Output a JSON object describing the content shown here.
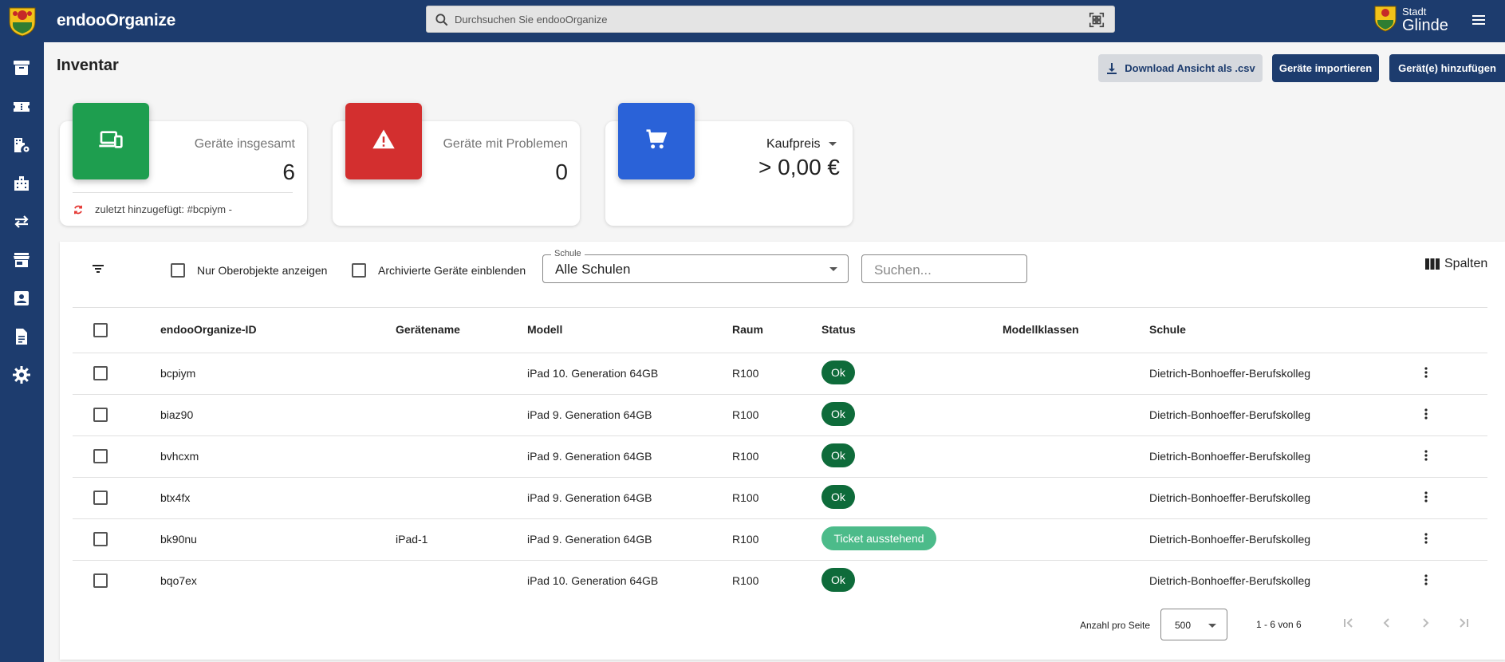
{
  "app": {
    "title": "endooOrganize",
    "search_placeholder": "Durchsuchen Sie endooOrganize",
    "city_small": "Stadt",
    "city_big": "Glinde"
  },
  "sidebar": {
    "items": [
      {
        "icon": "archive-icon"
      },
      {
        "icon": "ticket-icon"
      },
      {
        "icon": "building-settings-icon"
      },
      {
        "icon": "buildings-icon"
      },
      {
        "icon": "swap-arrows-icon"
      },
      {
        "icon": "store-icon"
      },
      {
        "icon": "contact-card-icon"
      },
      {
        "icon": "document-icon"
      },
      {
        "icon": "gear-icon"
      }
    ]
  },
  "header": {
    "title": "Inventar",
    "csv_button": "Download Ansicht als .csv",
    "import_button": "Geräte importieren",
    "add_button": "Gerät(e) hinzufügen"
  },
  "stats": {
    "total": {
      "label": "Geräte insgesamt",
      "value": "6",
      "footer": "zuletzt hinzugefügt: #bcpiym -"
    },
    "problems": {
      "label": "Geräte mit Problemen",
      "value": "0"
    },
    "price": {
      "label": "Kaufpreis",
      "value": "> 0,00 €"
    }
  },
  "filters": {
    "only_parent": "Nur Oberobjekte anzeigen",
    "show_archived": "Archivierte Geräte einblenden",
    "school_label": "Schule",
    "school_value": "Alle Schulen",
    "search_placeholder": "Suchen...",
    "columns_button": "Spalten"
  },
  "table": {
    "headers": {
      "id": "endooOrganize-ID",
      "name": "Gerätename",
      "model": "Modell",
      "room": "Raum",
      "status": "Status",
      "classes": "Modellklassen",
      "school": "Schule"
    },
    "rows": [
      {
        "id": "bcpiym",
        "name": "",
        "model": "iPad 10. Generation 64GB",
        "room": "R100",
        "status": "Ok",
        "classes": "",
        "school": "Dietrich-Bonhoeffer-Berufskolleg"
      },
      {
        "id": "biaz90",
        "name": "",
        "model": "iPad 9. Generation 64GB",
        "room": "R100",
        "status": "Ok",
        "classes": "",
        "school": "Dietrich-Bonhoeffer-Berufskolleg"
      },
      {
        "id": "bvhcxm",
        "name": "",
        "model": "iPad 9. Generation 64GB",
        "room": "R100",
        "status": "Ok",
        "classes": "",
        "school": "Dietrich-Bonhoeffer-Berufskolleg"
      },
      {
        "id": "btx4fx",
        "name": "",
        "model": "iPad 9. Generation 64GB",
        "room": "R100",
        "status": "Ok",
        "classes": "",
        "school": "Dietrich-Bonhoeffer-Berufskolleg"
      },
      {
        "id": "bk90nu",
        "name": "iPad-1",
        "model": "iPad 9. Generation 64GB",
        "room": "R100",
        "status": "Ticket ausstehend",
        "classes": "",
        "school": "Dietrich-Bonhoeffer-Berufskolleg"
      },
      {
        "id": "bqo7ex",
        "name": "",
        "model": "iPad 10. Generation 64GB",
        "room": "R100",
        "status": "Ok",
        "classes": "",
        "school": "Dietrich-Bonhoeffer-Berufskolleg"
      }
    ]
  },
  "pagination": {
    "per_page_label": "Anzahl pro Seite",
    "per_page_value": "500",
    "range": "1 - 6 von 6"
  },
  "colors": {
    "primary": "#1d3c6e",
    "ok_chip": "#0e6b3a",
    "ticket_chip": "#4cbb8a",
    "card_green": "#1e9e4f",
    "card_red": "#d32f2f",
    "card_blue": "#2a62d8"
  }
}
